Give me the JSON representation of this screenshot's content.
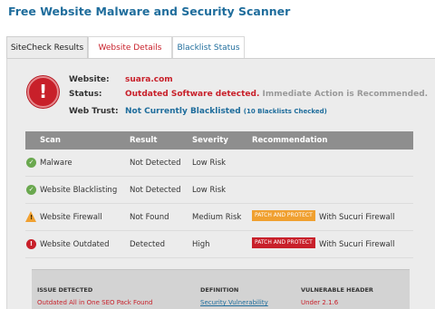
{
  "page": {
    "title": "Free Website Malware and Security Scanner"
  },
  "tabs": [
    {
      "label": "SiteCheck Results"
    },
    {
      "label": "Website Details"
    },
    {
      "label": "Blacklist Status"
    }
  ],
  "summary": {
    "website_label": "Website:",
    "website_value": "suara.com",
    "status_label": "Status:",
    "status_value": "Outdated Software detected.",
    "status_note": "Immediate Action is Recommended.",
    "trust_label": "Web Trust:",
    "trust_value": "Not Currently Blacklisted",
    "trust_note": "(10 Blacklists Checked)",
    "alert_glyph": "!"
  },
  "scan_table": {
    "headers": [
      "Scan",
      "Result",
      "Severity",
      "Recommendation"
    ],
    "rows": [
      {
        "icon": "check-icon",
        "scan": "Malware",
        "result": "Not Detected",
        "severity": "Low Risk",
        "badge": "",
        "recommendation": ""
      },
      {
        "icon": "check-icon",
        "scan": "Website Blacklisting",
        "result": "Not Detected",
        "severity": "Low Risk",
        "badge": "",
        "recommendation": ""
      },
      {
        "icon": "warning-icon",
        "scan": "Website Firewall",
        "result": "Not Found",
        "severity": "Medium Risk",
        "badge": "PATCH AND PROTECT",
        "recommendation": "With Sucuri Firewall"
      },
      {
        "icon": "alert-icon",
        "scan": "Website Outdated",
        "result": "Detected",
        "severity": "High",
        "badge": "PATCH AND PROTECT",
        "recommendation": "With Sucuri Firewall"
      }
    ]
  },
  "issues": {
    "headers": [
      "ISSUE DETECTED",
      "DEFINITION",
      "VULNERABLE HEADER"
    ],
    "rows": [
      {
        "issue": "Outdated All in One SEO Pack Found",
        "definition": "Security Vulnerability",
        "header": "Under 2.1.6"
      }
    ]
  },
  "colors": {
    "brand_blue": "#1f6d9c",
    "alert_red": "#c8202a",
    "warn_orange": "#f0a030",
    "ok_green": "#6aa84f"
  }
}
